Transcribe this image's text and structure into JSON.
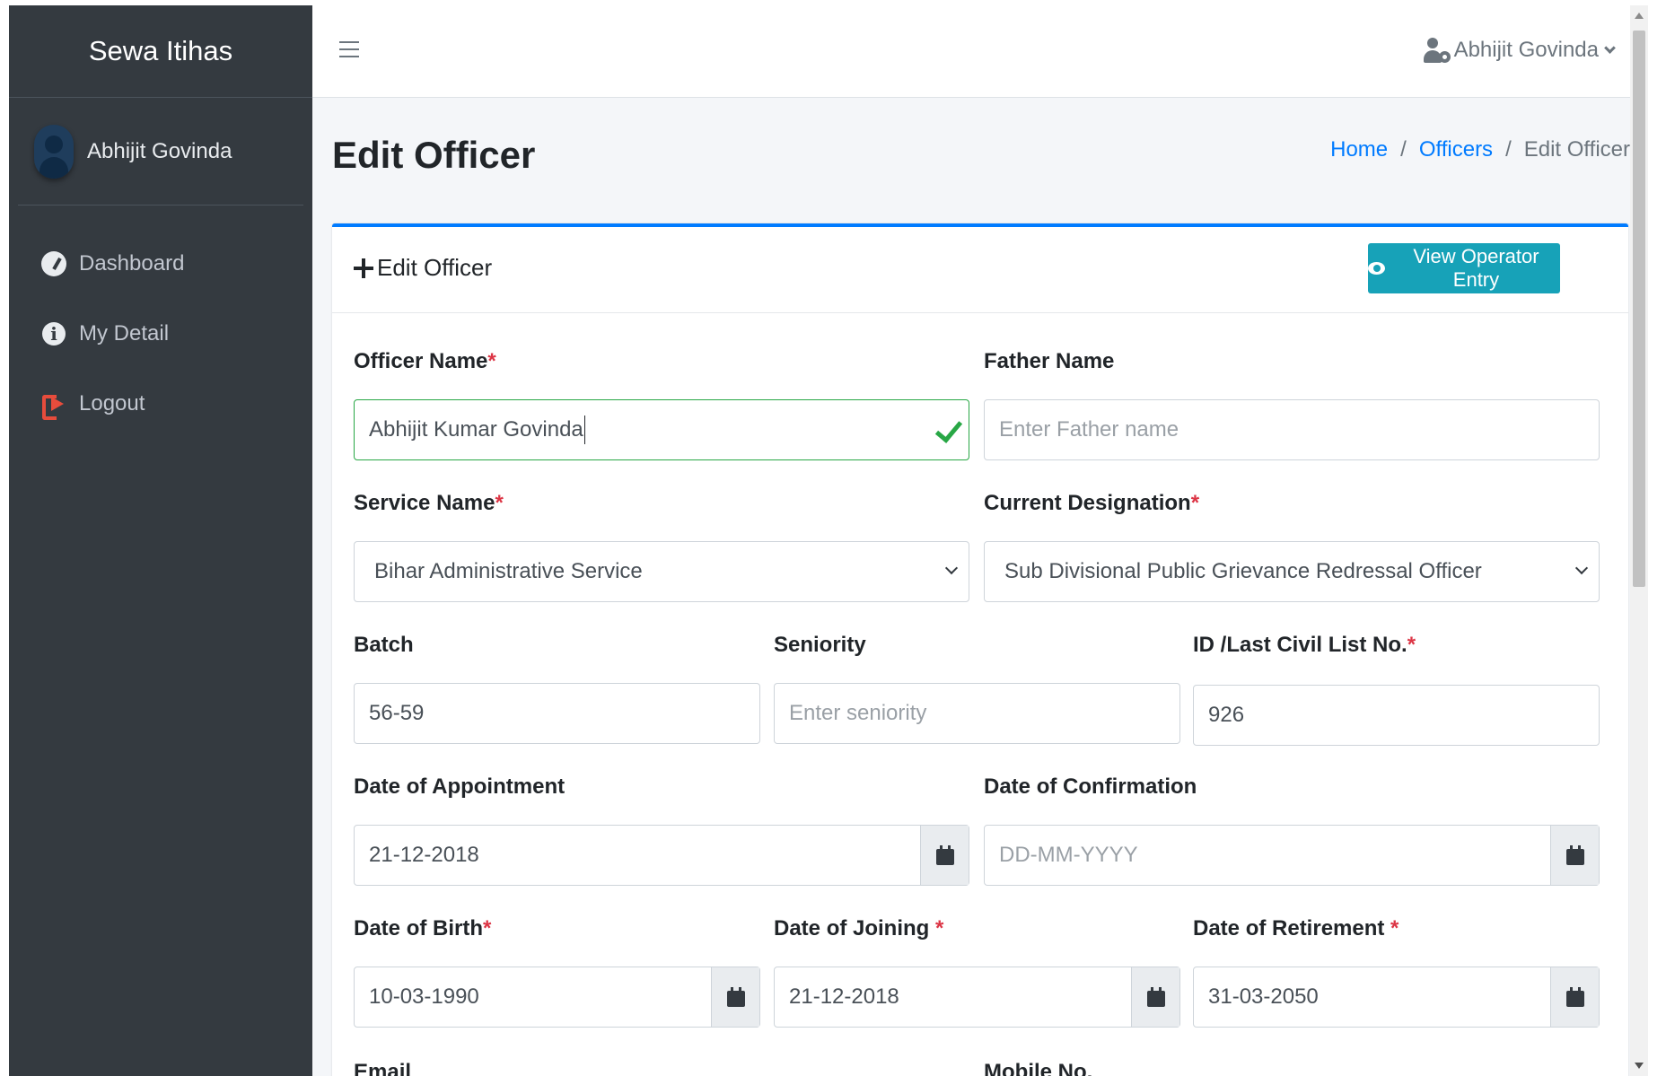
{
  "brand": "Sewa Itihas",
  "sidebar": {
    "user_name": "Abhijit Govinda",
    "items": [
      {
        "label": "Dashboard",
        "icon": "dashboard-icon"
      },
      {
        "label": "My Detail",
        "icon": "info-icon"
      },
      {
        "label": "Logout",
        "icon": "logout-icon"
      }
    ]
  },
  "topbar": {
    "user_name": "Abhijit Govinda"
  },
  "page": {
    "title": "Edit Officer",
    "breadcrumb": [
      "Home",
      "/",
      "Officers",
      "/",
      "Edit Officer"
    ]
  },
  "card": {
    "title": "Edit Officer",
    "view_button": "View Operator Entry"
  },
  "form": {
    "officer_name": {
      "label": "Officer Name",
      "required": "*",
      "value": "Abhijit Kumar Govinda"
    },
    "father_name": {
      "label": "Father Name",
      "placeholder": "Enter Father name"
    },
    "service_name": {
      "label": "Service Name",
      "required": "*",
      "value": "Bihar Administrative Service"
    },
    "current_designation": {
      "label": "Current Designation",
      "required": "*",
      "value": "Sub Divisional Public Grievance Redressal Officer"
    },
    "batch": {
      "label": "Batch",
      "value": "56-59"
    },
    "seniority": {
      "label": "Seniority",
      "placeholder": "Enter seniority"
    },
    "civil_list_no": {
      "label": "ID /Last Civil List No.",
      "required": "*",
      "value": "926"
    },
    "date_of_appointment": {
      "label": "Date of Appointment",
      "value": "21-12-2018"
    },
    "date_of_confirmation": {
      "label": "Date of Confirmation",
      "placeholder": "DD-MM-YYYY"
    },
    "date_of_birth": {
      "label": "Date of Birth",
      "required": "*",
      "value": "10-03-1990"
    },
    "date_of_joining": {
      "label": "Date of Joining ",
      "required": "*",
      "value": "21-12-2018"
    },
    "date_of_retirement": {
      "label": "Date of Retirement ",
      "required": "*",
      "value": "31-03-2050"
    },
    "email": {
      "label": "Email"
    },
    "mobile": {
      "label": "Mobile No."
    }
  },
  "colors": {
    "sidebar_bg": "#343a40",
    "primary": "#007bff",
    "info": "#17a2b8",
    "success": "#28a745",
    "danger": "#dc3545"
  }
}
